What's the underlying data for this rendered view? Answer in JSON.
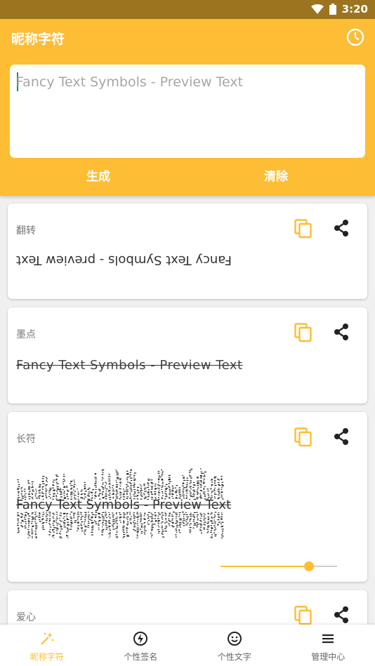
{
  "status_bar": {
    "time": "3:20"
  },
  "app_bar": {
    "title": "昵称字符",
    "input": {
      "placeholder": "Fancy Text Symbols - Preview Text",
      "value": ""
    },
    "generate_label": "生成",
    "clear_label": "清除"
  },
  "cards": [
    {
      "label": "翻转",
      "text": "Fancy Text Symbols - preview Text"
    },
    {
      "label": "墨点",
      "text": "Fancy Text Symbols - Preview Text"
    },
    {
      "label": "长符",
      "text": "Fancy Text Symbols - Preview Text",
      "slider_fraction": 0.76
    },
    {
      "label": "爱心"
    }
  ],
  "bottom_nav": [
    {
      "label": "昵称字符",
      "icon": "magic-wand-icon",
      "active": true
    },
    {
      "label": "个性签名",
      "icon": "bolt-icon",
      "active": false
    },
    {
      "label": "个性文字",
      "icon": "smiley-icon",
      "active": false
    },
    {
      "label": "管理中心",
      "icon": "menu-icon",
      "active": false
    }
  ],
  "colors": {
    "accent": "#fdbd34",
    "status_bar": "#9c7420"
  }
}
